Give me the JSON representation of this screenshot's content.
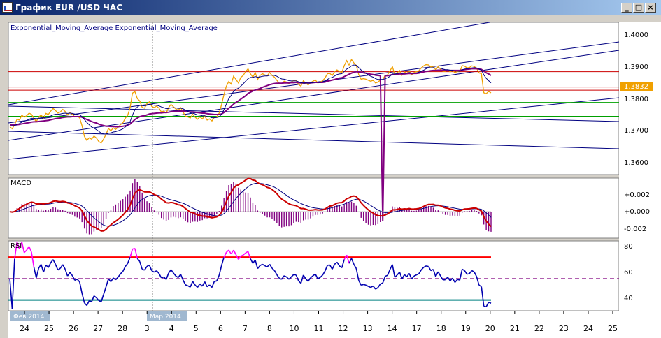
{
  "window": {
    "title": "График EUR /USD  ЧАС",
    "buttons": {
      "minimize": "_",
      "maximize": "□",
      "close": "×"
    }
  },
  "colors": {
    "price": "#f0a000",
    "ema_fast": "#000080",
    "ema_slow": "#800080",
    "trend_line": "#000080",
    "level_red": "#cc0000",
    "level_green": "#00a000",
    "macd_line": "#cc0000",
    "macd_signal": "#000080",
    "macd_hist": "#800080",
    "rsi_line": "#0000b0",
    "rsi_overbought": "#ff00ff",
    "rsi_level_high": "#ff0000",
    "rsi_level_low": "#008080",
    "rsi_level_mid": "#800080",
    "price_tag_bg": "#f0a000"
  },
  "main_panel": {
    "legend": "Exponential_Moving_Average Exponential_Moving_Average",
    "y_ticks": [
      "1.4000",
      "1.3900",
      "1.3800",
      "1.3700",
      "1.3600"
    ],
    "current_price": "1.3832"
  },
  "macd_panel": {
    "label": "MACD",
    "y_ticks": [
      "+0.002",
      "+0.000",
      "-0.002"
    ]
  },
  "rsi_panel": {
    "label": "RSI",
    "y_ticks": [
      "80",
      "60",
      "40"
    ]
  },
  "x_axis": {
    "ticks": [
      "24",
      "25",
      "26",
      "27",
      "28",
      "3",
      "4",
      "5",
      "6",
      "7",
      "8",
      "10",
      "11",
      "12",
      "13",
      "14",
      "17",
      "18",
      "19",
      "20",
      "21",
      "22",
      "23",
      "24",
      "25"
    ],
    "month_labels": [
      "Фев 2014",
      "Мар 2014"
    ]
  },
  "chart_data": {
    "type": "line",
    "ylim": [
      1.355,
      1.4075
    ],
    "hours_total": 240,
    "levels": {
      "red": [
        1.3905,
        1.3852,
        1.3841
      ],
      "green": [
        1.3799,
        1.3751
      ]
    },
    "price": [
      1.3715,
      1.3708,
      1.3722,
      1.3741,
      1.3738,
      1.3755,
      1.3748,
      1.3753,
      1.3762,
      1.3758,
      1.3745,
      1.3732,
      1.3748,
      1.3756,
      1.3745,
      1.3761,
      1.3757,
      1.3769,
      1.3778,
      1.3771,
      1.3762,
      1.3766,
      1.3775,
      1.3768,
      1.3756,
      1.3764,
      1.3758,
      1.3749,
      1.3751,
      1.3746,
      1.3719,
      1.3682,
      1.3668,
      1.3677,
      1.3672,
      1.3683,
      1.3676,
      1.3664,
      1.3659,
      1.3673,
      1.3689,
      1.3709,
      1.3701,
      1.3711,
      1.3706,
      1.3713,
      1.3722,
      1.3729,
      1.3744,
      1.3755,
      1.3781,
      1.3831,
      1.3836,
      1.3812,
      1.3804,
      1.3782,
      1.3779,
      1.3795,
      1.3801,
      1.3785,
      1.3781,
      1.3786,
      1.3779,
      1.3766,
      1.3769,
      1.3762,
      1.3781,
      1.3792,
      1.3784,
      1.3776,
      1.3772,
      1.3781,
      1.3766,
      1.3752,
      1.3749,
      1.3745,
      1.3758,
      1.3748,
      1.3741,
      1.3749,
      1.3742,
      1.3752,
      1.3738,
      1.3742,
      1.3735,
      1.3748,
      1.3749,
      1.3762,
      1.3791,
      1.3826,
      1.3855,
      1.3871,
      1.3862,
      1.3889,
      1.3878,
      1.3866,
      1.3885,
      1.3892,
      1.3905,
      1.3915,
      1.3898,
      1.3886,
      1.3902,
      1.3878,
      1.3892,
      1.3898,
      1.3894,
      1.3891,
      1.3902,
      1.3892,
      1.3886,
      1.3875,
      1.3865,
      1.3862,
      1.3872,
      1.3869,
      1.3863,
      1.3869,
      1.3875,
      1.3874,
      1.3861,
      1.3855,
      1.3874,
      1.3865,
      1.3859,
      1.3867,
      1.3872,
      1.3876,
      1.3866,
      1.3869,
      1.3874,
      1.3883,
      1.3898,
      1.3899,
      1.3892,
      1.3905,
      1.3911,
      1.3905,
      1.3902,
      1.3926,
      1.3943,
      1.3928,
      1.3947,
      1.3935,
      1.3926,
      1.3895,
      1.3879,
      1.3881,
      1.3879,
      1.3875,
      1.3872,
      1.3875,
      1.3866,
      1.3869,
      1.3876,
      1.3878,
      1.3892,
      1.3894,
      1.3908,
      1.3922,
      1.3895,
      1.3901,
      1.3909,
      1.3893,
      1.3904,
      1.3899,
      1.3908,
      1.3894,
      1.3902,
      1.3905,
      1.3908,
      1.3918,
      1.3925,
      1.3929,
      1.3928,
      1.3921,
      1.3924,
      1.3911,
      1.3922,
      1.3914,
      1.3906,
      1.3906,
      1.3911,
      1.3904,
      1.3909,
      1.3901,
      1.3906,
      1.3905,
      1.3926,
      1.3924,
      1.3918,
      1.3919,
      1.3925,
      1.3923,
      1.3916,
      1.3901,
      1.3898,
      1.3832,
      1.3829,
      1.3837,
      1.3832
    ],
    "ema_fast": [
      1.3718,
      1.3718,
      1.3719,
      1.3723,
      1.3726,
      1.3731,
      1.3734,
      1.3737,
      1.3741,
      1.3744,
      1.3744,
      1.3743,
      1.3744,
      1.3746,
      1.3746,
      1.3748,
      1.3749,
      1.3752,
      1.3756,
      1.3758,
      1.3758,
      1.3759,
      1.3761,
      1.3762,
      1.3761,
      1.3762,
      1.3761,
      1.3759,
      1.3758,
      1.3756,
      1.375,
      1.374,
      1.373,
      1.3722,
      1.3714,
      1.371,
      1.3705,
      1.3699,
      1.3693,
      1.369,
      1.369,
      1.3693,
      1.3694,
      1.3697,
      1.3698,
      1.3701,
      1.3704,
      1.3708,
      1.3714,
      1.3721,
      1.3733,
      1.3755,
      1.3774,
      1.3783,
      1.3789,
      1.3788,
      1.3787,
      1.3789,
      1.3792,
      1.3791,
      1.3789,
      1.3789,
      1.3787,
      1.3783,
      1.3781,
      1.3777,
      1.3778,
      1.378,
      1.3781,
      1.378,
      1.3778,
      1.3779,
      1.3777,
      1.3772,
      1.3768,
      1.3763,
      1.3762,
      1.3759,
      1.3756,
      1.3755,
      1.3753,
      1.3753,
      1.375,
      1.3749,
      1.3746,
      1.3746,
      1.3747,
      1.3749,
      1.3758,
      1.3774,
      1.3793,
      1.3812,
      1.3823,
      1.3837,
      1.3844,
      1.3848,
      1.3855,
      1.3863,
      1.3872,
      1.3881,
      1.3885,
      1.3885,
      1.3888,
      1.3886,
      1.3887,
      1.3889,
      1.389,
      1.389,
      1.3893,
      1.3893,
      1.3892,
      1.3889,
      1.3884,
      1.388,
      1.3879,
      1.3877,
      1.3874,
      1.3873,
      1.3873,
      1.3873,
      1.387,
      1.3866,
      1.3868,
      1.3867,
      1.3865,
      1.3866,
      1.3867,
      1.3869,
      1.3868,
      1.3868,
      1.3869,
      1.3872,
      1.3878,
      1.3883,
      1.3885,
      1.389,
      1.3895,
      1.3897,
      1.3898,
      1.3906,
      1.3914,
      1.3918,
      1.3925,
      1.3928,
      1.3927,
      1.3919,
      1.3911,
      1.3905,
      1.3899,
      1.3894,
      1.3889,
      1.3886,
      1.3881,
      1.3878,
      1.3878,
      1.3878,
      1.3881,
      1.3884,
      1.3889,
      1.3897,
      1.3897,
      1.3898,
      1.3901,
      1.3899,
      1.39,
      1.39,
      1.3902,
      1.39,
      1.39,
      1.3901,
      1.3903,
      1.3906,
      1.391,
      1.3915,
      1.3918,
      1.3918,
      1.3919,
      1.3917,
      1.3918,
      1.3917,
      1.3914,
      1.3912,
      1.3912,
      1.391,
      1.391,
      1.3907,
      1.3907,
      1.3906,
      1.3911,
      1.3914,
      1.3915,
      1.3916,
      1.3918,
      1.3919,
      1.3918,
      1.3914,
      1.3911,
      1.3894,
      1.3882,
      1.3874,
      1.3866
    ],
    "ema_slow": [
      1.3722,
      1.3721,
      1.3721,
      1.3722,
      1.3723,
      1.3725,
      1.3726,
      1.3728,
      1.3729,
      1.3731,
      1.3732,
      1.3732,
      1.3733,
      1.3734,
      1.3735,
      1.3736,
      1.3737,
      1.3739,
      1.3741,
      1.3743,
      1.3744,
      1.3745,
      1.3747,
      1.3748,
      1.3749,
      1.3749,
      1.375,
      1.375,
      1.375,
      1.375,
      1.3748,
      1.3744,
      1.374,
      1.3737,
      1.3733,
      1.373,
      1.3728,
      1.3724,
      1.3721,
      1.3719,
      1.3717,
      1.3717,
      1.3716,
      1.3716,
      1.3715,
      1.3715,
      1.3716,
      1.3717,
      1.3718,
      1.3721,
      1.3724,
      1.3732,
      1.374,
      1.3745,
      1.375,
      1.3752,
      1.3753,
      1.3756,
      1.3759,
      1.376,
      1.3761,
      1.3762,
      1.3763,
      1.3763,
      1.3764,
      1.3764,
      1.3765,
      1.3767,
      1.3768,
      1.3768,
      1.3768,
      1.3769,
      1.3769,
      1.3768,
      1.3767,
      1.3766,
      1.3766,
      1.3765,
      1.3764,
      1.3763,
      1.3762,
      1.3762,
      1.376,
      1.3759,
      1.3758,
      1.3757,
      1.3757,
      1.3757,
      1.3759,
      1.3764,
      1.3771,
      1.3779,
      1.3785,
      1.3793,
      1.3799,
      1.3804,
      1.381,
      1.3816,
      1.3822,
      1.383,
      1.3834,
      1.3838,
      1.3842,
      1.3844,
      1.3847,
      1.3851,
      1.3854,
      1.3857,
      1.386,
      1.3862,
      1.3864,
      1.3865,
      1.3865,
      1.3865,
      1.3866,
      1.3866,
      1.3866,
      1.3867,
      1.3867,
      1.3868,
      1.3867,
      1.3866,
      1.3867,
      1.3867,
      1.3866,
      1.3866,
      1.3867,
      1.3868,
      1.3868,
      1.3868,
      1.3868,
      1.3869,
      1.3872,
      1.3874,
      1.3876,
      1.3878,
      1.3881,
      1.3883,
      1.3884,
      1.3888,
      1.3892,
      1.3896,
      1.39,
      1.3903,
      1.3905,
      1.3904,
      1.3903,
      1.3901,
      1.39,
      1.3898,
      1.3896,
      1.3895,
      1.3893,
      1.3892,
      1.3891,
      1.339,
      1.3891,
      1.3891,
      1.3893,
      1.3895,
      1.3895,
      1.3896,
      1.3897,
      1.3897,
      1.3897,
      1.3898,
      1.3899,
      1.3898,
      1.3899,
      1.3899,
      1.39,
      1.3902,
      1.3904,
      1.3906,
      1.3907,
      1.3908,
      1.3909,
      1.3909,
      1.391,
      1.391,
      1.391,
      1.3909,
      1.3909,
      1.3909,
      1.3909,
      1.3909,
      1.3909,
      1.3909,
      1.3911,
      1.3912,
      1.3913,
      1.3914,
      1.3915,
      1.3915,
      1.3915,
      1.3914,
      1.3913,
      1.3907,
      1.3901,
      1.3897,
      1.3892
    ],
    "macd_hist_note": "derived from price EMAs in script",
    "rsi_overbought_level": 70,
    "rsi_oversold_level": 30,
    "rsi_mid_level": 50
  }
}
